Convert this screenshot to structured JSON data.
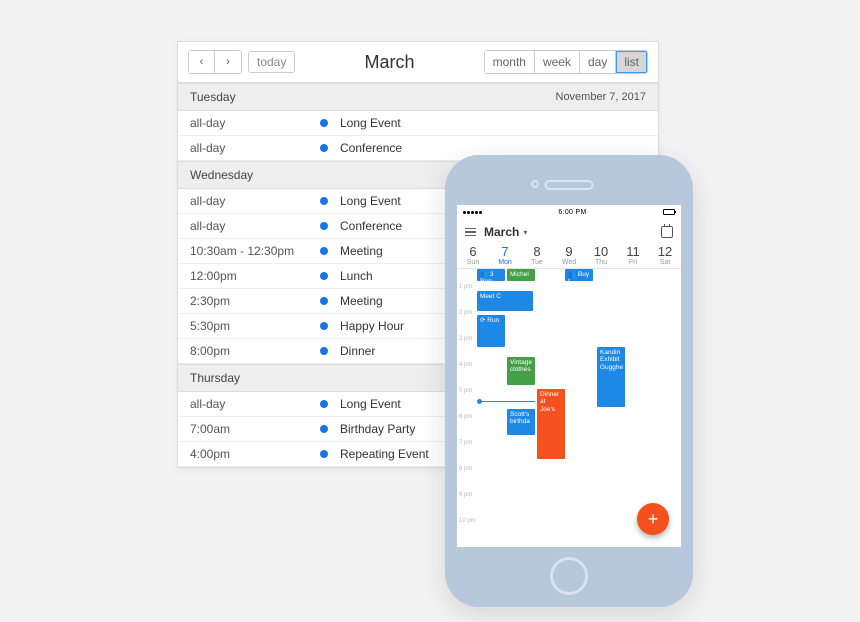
{
  "calendar": {
    "title": "March",
    "today_label": "today",
    "views": {
      "month": "month",
      "week": "week",
      "day": "day",
      "list": "list"
    },
    "active_view": "list",
    "days": [
      {
        "dow": "Tuesday",
        "date": "November 7, 2017",
        "events": [
          {
            "time": "all-day",
            "title": "Long Event"
          },
          {
            "time": "all-day",
            "title": "Conference"
          }
        ]
      },
      {
        "dow": "Wednesday",
        "date": "",
        "events": [
          {
            "time": "all-day",
            "title": "Long Event"
          },
          {
            "time": "all-day",
            "title": "Conference"
          },
          {
            "time": "10:30am - 12:30pm",
            "title": "Meeting"
          },
          {
            "time": "12:00pm",
            "title": "Lunch"
          },
          {
            "time": "2:30pm",
            "title": "Meeting"
          },
          {
            "time": "5:30pm",
            "title": "Happy Hour"
          },
          {
            "time": "8:00pm",
            "title": "Dinner"
          }
        ]
      },
      {
        "dow": "Thursday",
        "date": "",
        "events": [
          {
            "time": "all-day",
            "title": "Long Event"
          },
          {
            "time": "7:00am",
            "title": "Birthday Party"
          },
          {
            "time": "4:00pm",
            "title": "Repeating Event"
          }
        ]
      }
    ]
  },
  "phone": {
    "status_time": "6:00 PM",
    "app_title": "March",
    "week": [
      {
        "num": "6",
        "lbl": "Sun"
      },
      {
        "num": "7",
        "lbl": "Mon"
      },
      {
        "num": "8",
        "lbl": "Tue"
      },
      {
        "num": "9",
        "lbl": "Wed"
      },
      {
        "num": "10",
        "lbl": "Thu"
      },
      {
        "num": "11",
        "lbl": "Fri"
      },
      {
        "num": "12",
        "lbl": "Sat"
      }
    ],
    "today_index": 1,
    "hours": [
      "1 pm",
      "2 pm",
      "3 pm",
      "4 pm",
      "5 pm",
      "6 pm",
      "7 pm",
      "8 pm",
      "9 pm",
      "10 pm"
    ],
    "events": {
      "e0": "👥 3 Rep",
      "e1": "Michel",
      "e2": "👥 Buy t",
      "e3": "Meet C",
      "e4": "⟳ Run",
      "e5": "Vintage clothes",
      "e6": "Scott's birthda",
      "e7": "Dinner at Joe's",
      "e8": "Kandin Exhibit Gugghe"
    },
    "fab": "+"
  }
}
